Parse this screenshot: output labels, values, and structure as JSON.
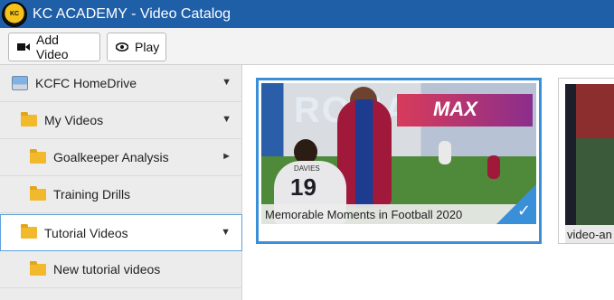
{
  "app": {
    "title": "KC ACADEMY - Video Catalog",
    "logo_text": "KAIZER CHIEFS"
  },
  "toolbar": {
    "add_video_label": "Add Video",
    "play_label": "Play"
  },
  "sidebar": {
    "items": [
      {
        "label": "KCFC HomeDrive",
        "icon": "drive-icon",
        "expander": "chevron-down-icon"
      },
      {
        "label": "My Videos",
        "icon": "folder-icon",
        "expander": "chevron-down-icon"
      },
      {
        "label": "Goalkeeper Analysis",
        "icon": "folder-icon",
        "expander": "chevron-right-icon"
      },
      {
        "label": "Training Drills",
        "icon": "folder-icon"
      },
      {
        "label": "Tutorial Videos",
        "icon": "folder-icon",
        "expander": "chevron-down-icon",
        "selected": true
      },
      {
        "label": "New tutorial videos",
        "icon": "folder-icon"
      }
    ]
  },
  "videos": [
    {
      "caption": "Memorable Moments in Football 2020",
      "selected": true,
      "jersey_name": "DAVIES",
      "jersey_number": "19",
      "board_left": "ROMA",
      "board_right": "MAX"
    },
    {
      "caption": "video-an"
    }
  ],
  "colors": {
    "titlebar": "#1f5fa8",
    "selection": "#3a8fd9",
    "folder": "#f2b92c",
    "sidebar_bg": "#ececec"
  }
}
